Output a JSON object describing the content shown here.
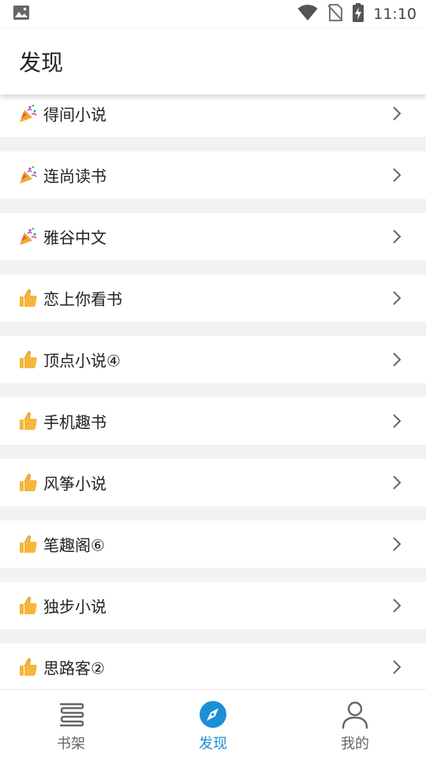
{
  "status_bar": {
    "time": "11:10",
    "icons": [
      "image-icon",
      "wifi-icon",
      "no-sim-icon",
      "battery-charging-icon"
    ]
  },
  "app_bar": {
    "title": "发现"
  },
  "list": {
    "items": [
      {
        "label": "得间小说",
        "icon": "party-popper-icon"
      },
      {
        "label": "连尚读书",
        "icon": "party-popper-icon"
      },
      {
        "label": "雅谷中文",
        "icon": "party-popper-icon"
      },
      {
        "label": "恋上你看书",
        "icon": "thumbs-up-icon"
      },
      {
        "label": "顶点小说④",
        "icon": "thumbs-up-icon"
      },
      {
        "label": "手机趣书",
        "icon": "thumbs-up-icon"
      },
      {
        "label": "风筝小说",
        "icon": "thumbs-up-icon"
      },
      {
        "label": "笔趣阁⑥",
        "icon": "thumbs-up-icon"
      },
      {
        "label": "独步小说",
        "icon": "thumbs-up-icon"
      },
      {
        "label": "思路客②",
        "icon": "thumbs-up-icon"
      }
    ]
  },
  "bottom_nav": {
    "items": [
      {
        "label": "书架",
        "icon": "bookshelf-icon",
        "active": false
      },
      {
        "label": "发现",
        "icon": "compass-icon",
        "active": true
      },
      {
        "label": "我的",
        "icon": "person-icon",
        "active": false
      }
    ]
  },
  "colors": {
    "accent": "#1b8fd6",
    "background": "#f2f2f2",
    "thumbs_up": "#f5b63a"
  }
}
